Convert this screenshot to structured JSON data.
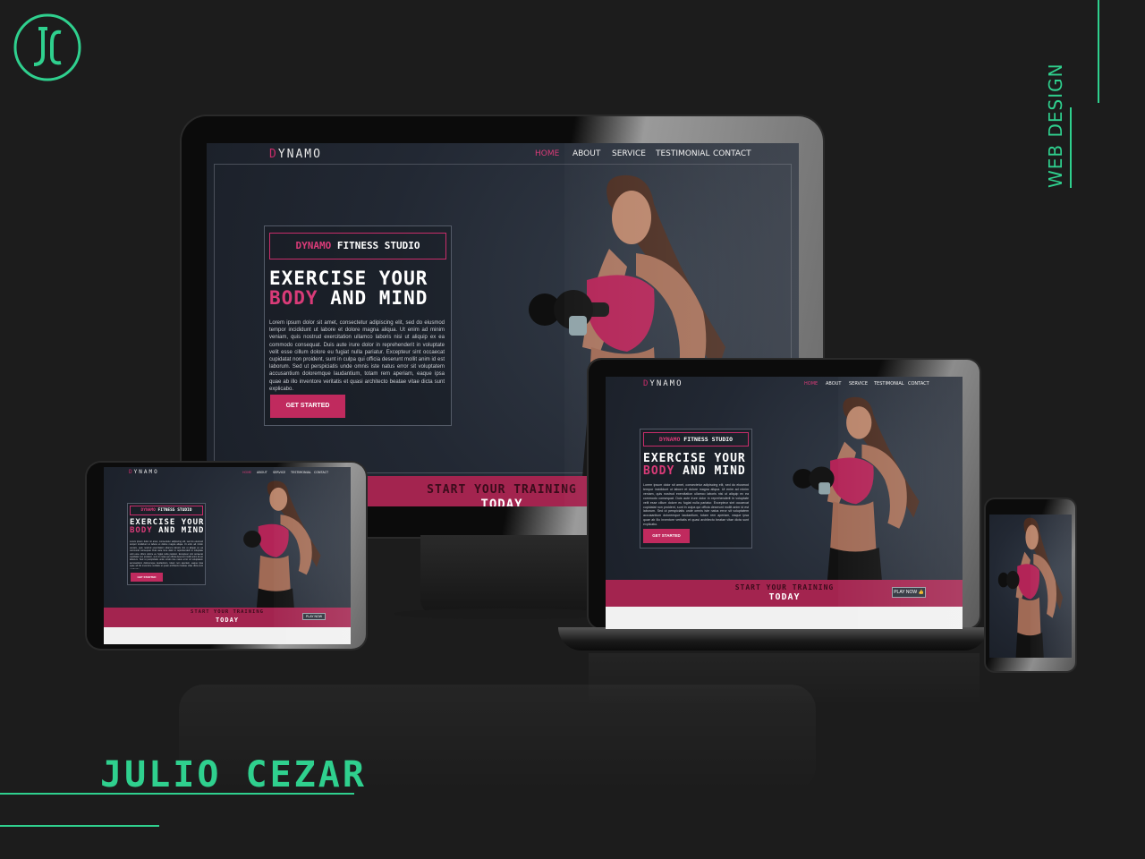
{
  "brand": {
    "side_label": "WEB DESIGN",
    "designer_name": "JULIO CEZAR",
    "accent_color": "#2fd08e"
  },
  "site": {
    "logo_d": "D",
    "logo_rest": "YNAMO",
    "nav": [
      "HOME",
      "ABOUT",
      "SERVICE",
      "TESTIMONIAL",
      "CONTACT"
    ],
    "tag_brand": "DYNAMO",
    "tag_rest": " FITNESS STUDIO",
    "headline_line1": "EXERCISE YOUR",
    "headline_pink": "BODY",
    "headline_rest": " AND MIND",
    "paragraph": "Lorem ipsum dolor sit amet, consectetur adipiscing elit, sed do eiusmod tempor incididunt ut labore et dolore magna aliqua. Ut enim ad minim veniam, quis nostrud exercitation ullamco laboris nisi ut aliquip ex ea commodo consequat. Duis aute irure dolor in reprehenderit in voluptate velit esse cillum dolore eu fugiat nulla pariatur. Excepteur sint occaecat cupidatat non proident, sunt in culpa qui officia deserunt mollit anim id est laborum. Sed ut perspiciatis unde omnis iste natus error sit voluptatem accusantium doloremque laudantium, totam rem aperiam, eaque ipsa quae ab illo inventore veritatis et quasi architecto beatae vitae dicta sunt explicabo.",
    "cta": "GET STARTED",
    "band_line1": "START YOUR TRAINING",
    "band_line2": "TODAY",
    "play": "PLAY NOW",
    "accent_pink": "#c92d6a"
  }
}
